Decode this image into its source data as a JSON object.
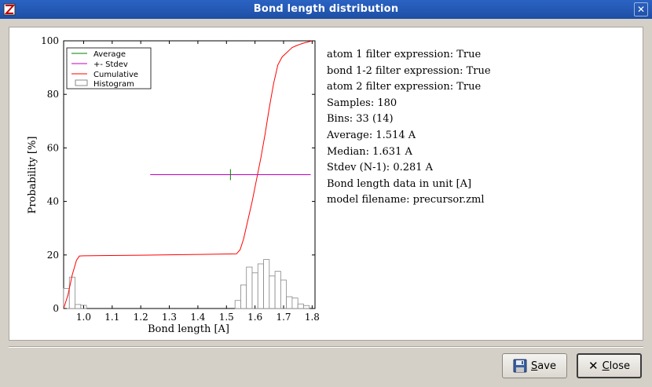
{
  "window": {
    "title": "Bond length distribution"
  },
  "info_lines": [
    "atom 1 filter expression: True",
    "bond 1-2 filter expression: True",
    "atom 2 filter expression: True",
    "Samples: 180",
    "Bins: 33 (14)",
    "Average: 1.514 A",
    "Median: 1.631 A",
    "Stdev (N-1): 0.281 A",
    "Bond length data in unit [A]",
    "model filename: precursor.zml"
  ],
  "buttons": {
    "save_key": "S",
    "save_rest": "ave",
    "close_key": "C",
    "close_rest": "lose"
  },
  "chart_data": {
    "type": "line",
    "xlabel": "Bond length [A]",
    "ylabel": "Probability [%]",
    "xlim": [
      0.93,
      1.81
    ],
    "ylim": [
      0,
      100
    ],
    "xticks": [
      "1.0",
      "1.1",
      "1.2",
      "1.3",
      "1.4",
      "1.5",
      "1.6",
      "1.7",
      "1.8"
    ],
    "yticks": [
      "0",
      "20",
      "40",
      "60",
      "80",
      "100"
    ],
    "legend": [
      "Average",
      "+- Stdev",
      "Cumulative",
      "Histogram"
    ],
    "legend_placement": "top-left",
    "colors": {
      "average": "#008000",
      "stdev": "#c000c0",
      "cumulative": "#ff0000",
      "histogram": "#888888"
    },
    "average": {
      "x": 1.514,
      "y": 50
    },
    "stdev_range": [
      1.233,
      1.795
    ],
    "histogram": {
      "bin_width": 0.02,
      "x": [
        0.94,
        0.96,
        0.98,
        1.0,
        1.54,
        1.56,
        1.58,
        1.6,
        1.62,
        1.64,
        1.66,
        1.68,
        1.7,
        1.72,
        1.74,
        1.76,
        1.78
      ],
      "values": [
        7.5,
        11.7,
        1.5,
        1.2,
        3.0,
        8.8,
        15.5,
        13.3,
        16.7,
        18.3,
        12.2,
        13.9,
        10.6,
        4.4,
        3.9,
        1.7,
        1.1
      ]
    },
    "cumulative": {
      "x": [
        0.93,
        0.945,
        0.96,
        0.975,
        0.985,
        1.0,
        1.2,
        1.4,
        1.535,
        1.548,
        1.56,
        1.575,
        1.59,
        1.605,
        1.62,
        1.635,
        1.65,
        1.665,
        1.68,
        1.695,
        1.71,
        1.72,
        1.73,
        1.745,
        1.76,
        1.775,
        1.79,
        1.8
      ],
      "y": [
        0,
        5,
        12.5,
        18,
        19.6,
        19.7,
        19.9,
        20.2,
        20.4,
        22,
        26,
        33,
        40,
        48,
        56,
        65,
        75,
        84,
        91,
        94,
        95.5,
        96.5,
        97.5,
        98.2,
        98.8,
        99.3,
        99.7,
        100
      ]
    }
  }
}
